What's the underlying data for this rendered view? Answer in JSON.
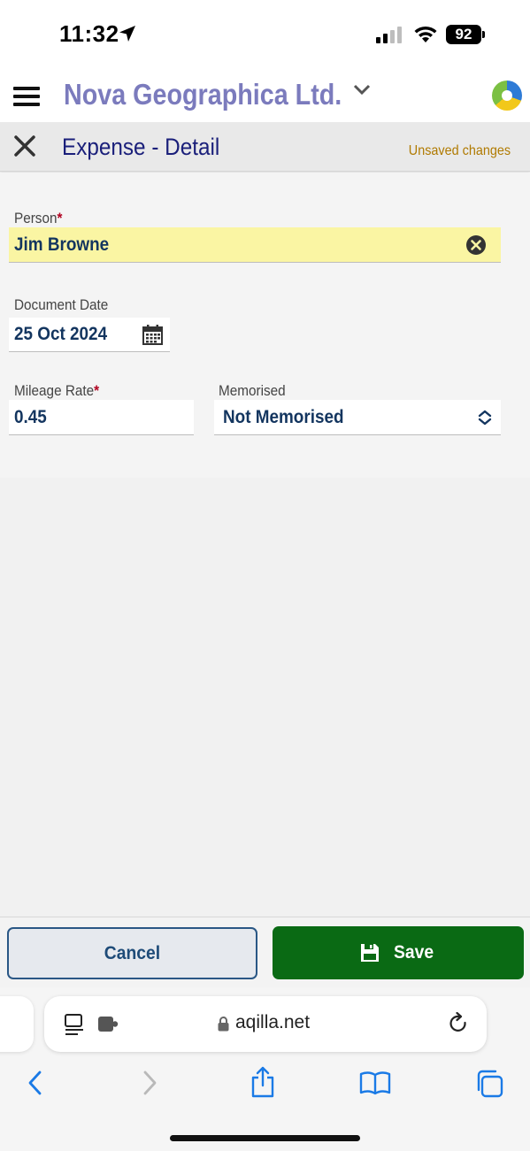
{
  "status_bar": {
    "time": "11:32",
    "battery": "92"
  },
  "header": {
    "company_name": "Nova Geographica Ltd."
  },
  "detail_bar": {
    "title": "Expense - Detail",
    "status": "Unsaved changes"
  },
  "form": {
    "person": {
      "label": "Person",
      "required": "*",
      "value": "Jim Browne"
    },
    "document_date": {
      "label": "Document Date",
      "value": "25 Oct 2024"
    },
    "mileage_rate": {
      "label": "Mileage Rate",
      "required": "*",
      "value": "0.45"
    },
    "memorised": {
      "label": "Memorised",
      "value": "Not Memorised"
    }
  },
  "actions": {
    "cancel_label": "Cancel",
    "save_label": "Save"
  },
  "browser": {
    "url": "aqilla.net"
  },
  "colors": {
    "company_accent": "#7b7bbd",
    "title_text": "#1a1f7a",
    "unsaved": "#b07a00",
    "person_highlight": "#faf5a3",
    "save_button": "#0a6a14",
    "cancel_border": "#2a5785",
    "safari_blue": "#1a7ae6"
  },
  "icons": {
    "location": "location-arrow-icon",
    "menu": "hamburger-menu-icon",
    "dropdown": "chevron-down-icon",
    "logo": "app-logo-icon",
    "close": "close-icon",
    "clear": "clear-circle-icon",
    "calendar": "calendar-icon",
    "select": "up-down-chevron-icon",
    "save": "floppy-disk-icon",
    "reader": "reader-mode-icon",
    "extension": "extension-puzzle-icon",
    "lock": "lock-icon",
    "reload": "reload-icon",
    "back": "back-chevron-icon",
    "forward": "forward-chevron-icon",
    "share": "share-icon",
    "bookmarks": "book-icon",
    "tabs": "tabs-icon"
  }
}
